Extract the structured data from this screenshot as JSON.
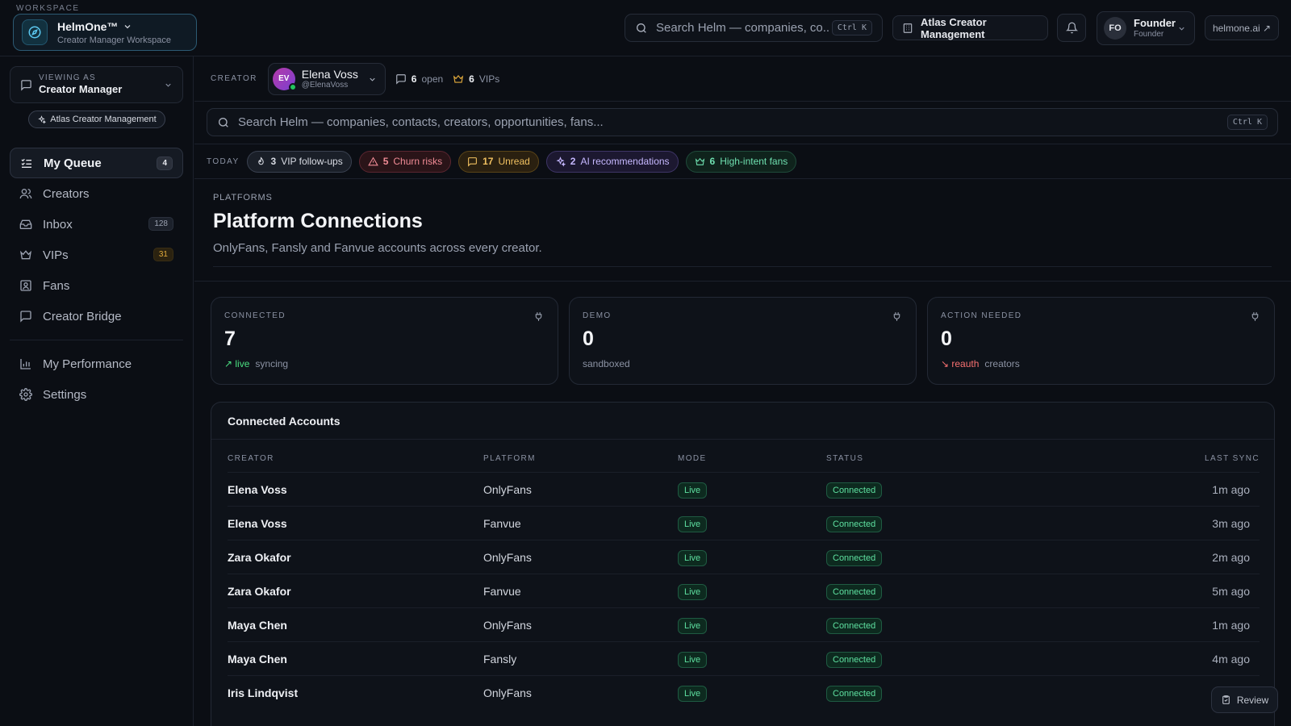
{
  "topbar": {
    "workspace_label": "WORKSPACE",
    "workspace_name": "HelmOne™",
    "workspace_sub": "Creator Manager Workspace",
    "search_placeholder": "Search Helm — companies, co...",
    "search_kbd": "Ctrl K",
    "org_button": "Atlas Creator Management",
    "user_initials": "FO",
    "user_name": "Founder",
    "user_role": "Founder",
    "site_link": "helmone.ai ↗"
  },
  "sidebar": {
    "viewing_label": "VIEWING AS",
    "viewing_value": "Creator Manager",
    "org_pill": "Atlas Creator Management",
    "items": [
      {
        "label": "My Queue",
        "badge": "4",
        "icon": "queue-icon"
      },
      {
        "label": "Creators",
        "badge": "",
        "icon": "users-icon"
      },
      {
        "label": "Inbox",
        "badge": "128",
        "icon": "inbox-icon"
      },
      {
        "label": "VIPs",
        "badge": "31",
        "icon": "crown-icon"
      },
      {
        "label": "Fans",
        "badge": "",
        "icon": "contact-icon"
      },
      {
        "label": "Creator Bridge",
        "badge": "",
        "icon": "message-icon"
      },
      {
        "label": "My Performance",
        "badge": "",
        "icon": "chart-icon"
      },
      {
        "label": "Settings",
        "badge": "",
        "icon": "gear-icon"
      }
    ]
  },
  "creator_bar": {
    "label": "CREATOR",
    "initials": "EV",
    "name": "Elena Voss",
    "handle": "@ElenaVoss",
    "open_count": "6",
    "open_label": "open",
    "vip_count": "6",
    "vip_label": "VIPs"
  },
  "main_search": {
    "placeholder": "Search Helm — companies, contacts, creators, opportunities, fans...",
    "kbd": "Ctrl K"
  },
  "today": {
    "label": "TODAY",
    "chips": [
      {
        "count": "3",
        "label": "VIP follow-ups"
      },
      {
        "count": "5",
        "label": "Churn risks"
      },
      {
        "count": "17",
        "label": "Unread"
      },
      {
        "count": "2",
        "label": "AI recommendations"
      },
      {
        "count": "6",
        "label": "High-intent fans"
      }
    ]
  },
  "page": {
    "crumb": "PLATFORMS",
    "title": "Platform Connections",
    "subtitle": "OnlyFans, Fansly and Fanvue accounts across every creator."
  },
  "cards": [
    {
      "label": "CONNECTED",
      "value": "7",
      "trend": "↗ live",
      "note": "syncing"
    },
    {
      "label": "DEMO",
      "value": "0",
      "trend": "",
      "note": "sandboxed"
    },
    {
      "label": "ACTION NEEDED",
      "value": "0",
      "trend": "↘ reauth",
      "note": "creators"
    }
  ],
  "table": {
    "title": "Connected Accounts",
    "columns": [
      "CREATOR",
      "PLATFORM",
      "MODE",
      "STATUS",
      "LAST SYNC"
    ],
    "rows": [
      {
        "creator": "Elena Voss",
        "platform": "OnlyFans",
        "mode": "Live",
        "status": "Connected",
        "last_sync": "1m ago"
      },
      {
        "creator": "Elena Voss",
        "platform": "Fanvue",
        "mode": "Live",
        "status": "Connected",
        "last_sync": "3m ago"
      },
      {
        "creator": "Zara Okafor",
        "platform": "OnlyFans",
        "mode": "Live",
        "status": "Connected",
        "last_sync": "2m ago"
      },
      {
        "creator": "Zara Okafor",
        "platform": "Fanvue",
        "mode": "Live",
        "status": "Connected",
        "last_sync": "5m ago"
      },
      {
        "creator": "Maya Chen",
        "platform": "OnlyFans",
        "mode": "Live",
        "status": "Connected",
        "last_sync": "1m ago"
      },
      {
        "creator": "Maya Chen",
        "platform": "Fansly",
        "mode": "Live",
        "status": "Connected",
        "last_sync": "4m ago"
      },
      {
        "creator": "Iris Lindqvist",
        "platform": "OnlyFans",
        "mode": "Live",
        "status": "Connected",
        "last_sync": ""
      }
    ]
  },
  "review_button": "Review"
}
